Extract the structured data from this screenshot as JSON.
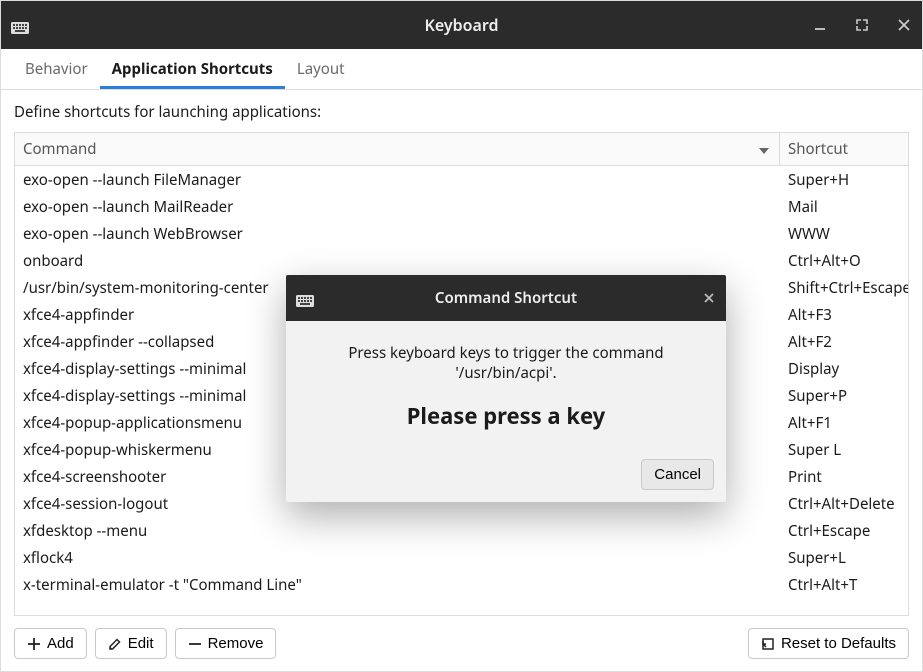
{
  "window": {
    "title": "Keyboard"
  },
  "tabs": {
    "behavior": "Behavior",
    "appshortcuts": "Application Shortcuts",
    "layout": "Layout"
  },
  "description": "Define shortcuts for launching applications:",
  "columns": {
    "command": "Command",
    "shortcut": "Shortcut"
  },
  "rows": [
    {
      "cmd": "exo-open --launch FileManager",
      "sc": "Super+H"
    },
    {
      "cmd": "exo-open --launch MailReader",
      "sc": "Mail"
    },
    {
      "cmd": "exo-open --launch WebBrowser",
      "sc": "WWW"
    },
    {
      "cmd": "onboard",
      "sc": "Ctrl+Alt+O"
    },
    {
      "cmd": "/usr/bin/system-monitoring-center",
      "sc": "Shift+Ctrl+Escape"
    },
    {
      "cmd": "xfce4-appfinder",
      "sc": "Alt+F3"
    },
    {
      "cmd": "xfce4-appfinder --collapsed",
      "sc": "Alt+F2"
    },
    {
      "cmd": "xfce4-display-settings --minimal",
      "sc": "Display"
    },
    {
      "cmd": "xfce4-display-settings --minimal",
      "sc": "Super+P"
    },
    {
      "cmd": "xfce4-popup-applicationsmenu",
      "sc": "Alt+F1"
    },
    {
      "cmd": "xfce4-popup-whiskermenu",
      "sc": "Super L"
    },
    {
      "cmd": "xfce4-screenshooter",
      "sc": "Print"
    },
    {
      "cmd": "xfce4-session-logout",
      "sc": "Ctrl+Alt+Delete"
    },
    {
      "cmd": "xfdesktop --menu",
      "sc": "Ctrl+Escape"
    },
    {
      "cmd": "xflock4",
      "sc": "Super+L"
    },
    {
      "cmd": "x-terminal-emulator -t \"Command Line\"",
      "sc": "Ctrl+Alt+T"
    }
  ],
  "buttons": {
    "add": "Add",
    "edit": "Edit",
    "remove": "Remove",
    "reset": "Reset to Defaults"
  },
  "dialog": {
    "title": "Command Shortcut",
    "message": "Press keyboard keys to trigger the command '/usr/bin/acpi'.",
    "prompt": "Please press a key",
    "cancel": "Cancel"
  }
}
